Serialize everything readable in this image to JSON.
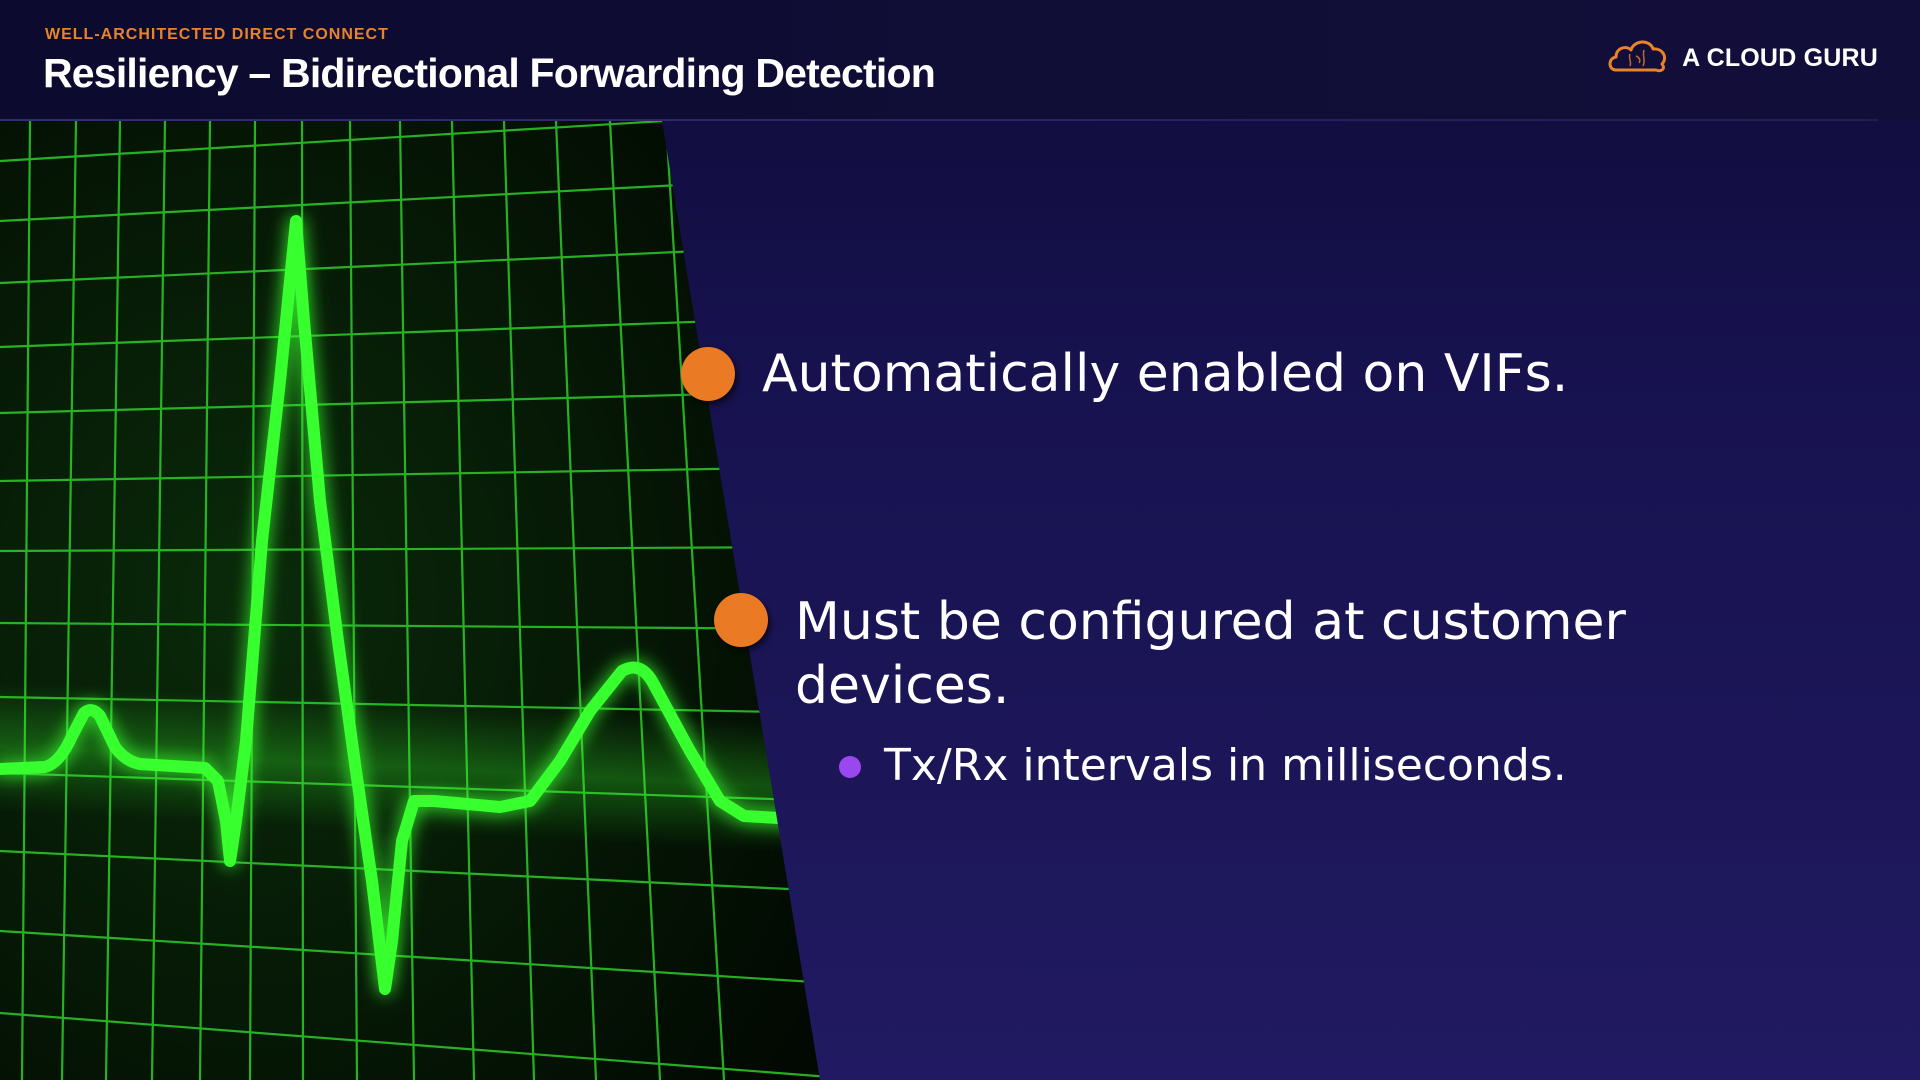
{
  "header": {
    "eyebrow": "WELL-ARCHITECTED DIRECT CONNECT",
    "title": "Resiliency – Bidirectional Forwarding Detection",
    "brand_name": "A CLOUD GURU",
    "brand_icon": "cloud-logo-icon"
  },
  "visual": {
    "subject": "heart-monitor-icon",
    "line_color": "#39ff2e",
    "grid_color": "#2ecc2a",
    "background_color": "#041004"
  },
  "bullets": [
    {
      "text": "Automatically enabled on VIFs."
    },
    {
      "line1": "Must be configured at customer",
      "line2": "devices.",
      "sub_items": [
        "Tx/Rx intervals in milliseconds."
      ]
    }
  ],
  "colors": {
    "accent_orange": "#ea7a23",
    "accent_purple": "#9b47f0",
    "background": "#1a1453"
  }
}
